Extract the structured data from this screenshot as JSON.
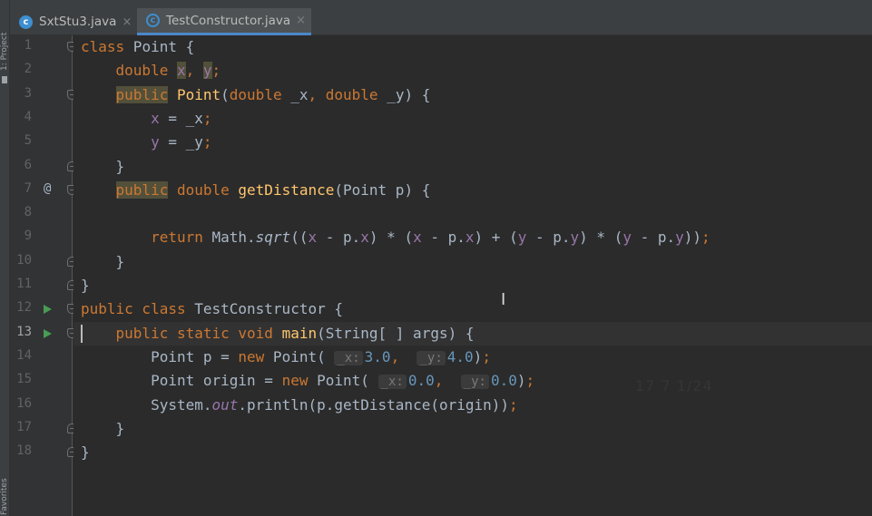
{
  "tool_window": {
    "project_label": "1: Project",
    "favorites_label": "Favorites"
  },
  "tabs": [
    {
      "icon": "c-class-icon",
      "label": "SxtStu3.java",
      "active": false
    },
    {
      "icon": "c-class-icon",
      "label": "TestConstructor.java",
      "active": true
    }
  ],
  "editor": {
    "current_line": 13,
    "line_numbers": [
      "1",
      "2",
      "3",
      "4",
      "5",
      "6",
      "7",
      "8",
      "9",
      "10",
      "11",
      "12",
      "13",
      "14",
      "15",
      "16",
      "17",
      "18"
    ],
    "gutter_markers": {
      "7": "@",
      "12": "run",
      "13": "run"
    },
    "watermark": "17 7 1/24"
  },
  "colors": {
    "background": "#2b2b2b",
    "keyword": "#cc7832",
    "method": "#ffc66d",
    "field": "#9876aa",
    "number": "#6897bb",
    "text": "#a9b7c6",
    "run_icon": "#499c54",
    "tab_underline": "#4a88c7"
  }
}
